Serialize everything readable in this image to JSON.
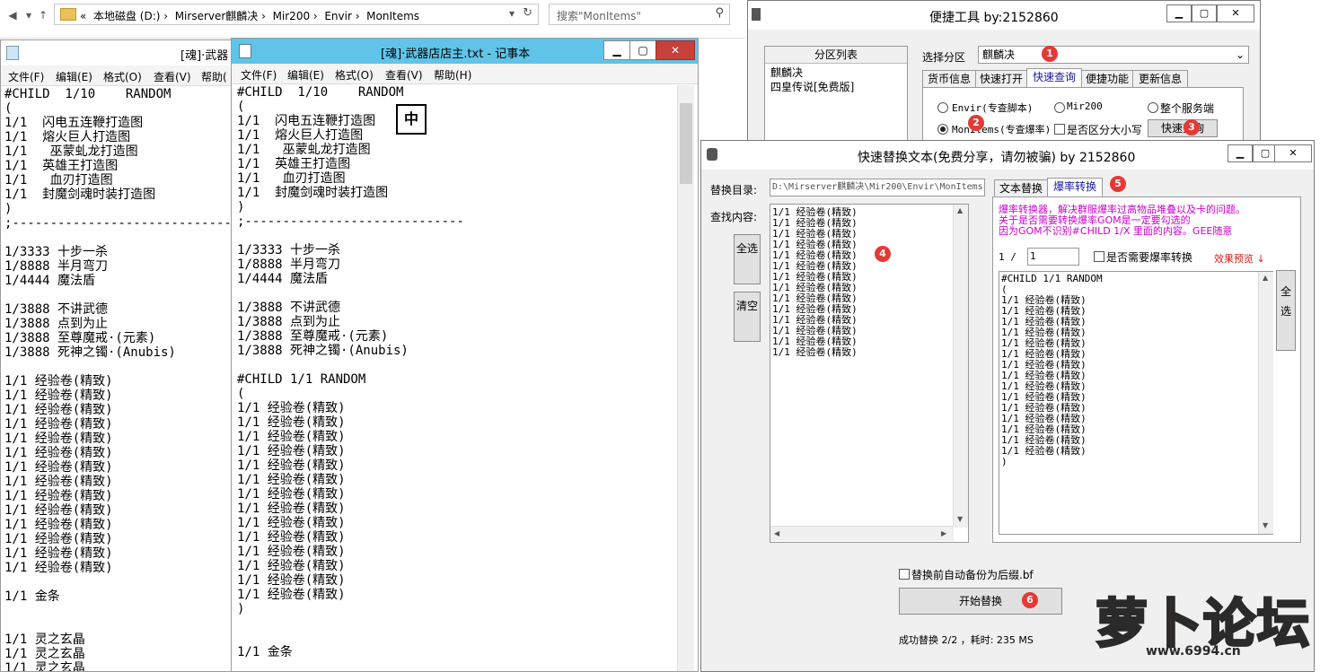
{
  "explorer": {
    "path_parts": [
      "«",
      "本地磁盘 (D:)",
      "Mirserver麒麟决",
      "Mir200",
      "Envir",
      "MonItems"
    ],
    "search_placeholder": "搜索\"MonItems\""
  },
  "notepad_left": {
    "title": "[魂]·武器",
    "menu": [
      "文件(F)",
      "编辑(E)",
      "格式(O)",
      "查看(V)",
      "帮助("
    ],
    "content": "#CHILD  1/10    RANDOM\n(\n1/1  闪电五连鞭打造图\n1/1  熔火巨人打造图\n1/1   巫蒙虬龙打造图\n1/1  英雄王打造图\n1/1   血刃打造图\n1/1  封魔剑魂时装打造图\n)\n;-----------------------------\n\n1/3333 十步一杀\n1/8888 半月弯刀\n1/4444 魔法盾\n\n1/3888 不讲武德\n1/3888 点到为止\n1/3888 至尊魔戒·(元素)\n1/3888 死神之镯·(Anubis)\n\n1/1 经验卷(精致)\n1/1 经验卷(精致)\n1/1 经验卷(精致)\n1/1 经验卷(精致)\n1/1 经验卷(精致)\n1/1 经验卷(精致)\n1/1 经验卷(精致)\n1/1 经验卷(精致)\n1/1 经验卷(精致)\n1/1 经验卷(精致)\n1/1 经验卷(精致)\n1/1 经验卷(精致)\n1/1 经验卷(精致)\n1/1 经验卷(精致)\n\n1/1 金条\n\n\n1/1 灵之玄晶\n1/1 灵之玄晶\n1/1 灵之玄晶"
  },
  "notepad_main": {
    "title": "[魂]·武器店店主.txt - 记事本",
    "menu": [
      "文件(F)",
      "编辑(E)",
      "格式(O)",
      "查看(V)",
      "帮助(H)"
    ],
    "ime": "中",
    "content": "#CHILD  1/10    RANDOM\n(\n1/1  闪电五连鞭打造图\n1/1  熔火巨人打造图\n1/1   巫蒙虬龙打造图\n1/1  英雄王打造图\n1/1   血刃打造图\n1/1  封魔剑魂时装打造图\n)\n;-----------------------------\n\n1/3333 十步一杀\n1/8888 半月弯刀\n1/4444 魔法盾\n\n1/3888 不讲武德\n1/3888 点到为止\n1/3888 至尊魔戒·(元素)\n1/3888 死神之镯·(Anubis)\n\n#CHILD 1/1 RANDOM\n(\n1/1 经验卷(精致)\n1/1 经验卷(精致)\n1/1 经验卷(精致)\n1/1 经验卷(精致)\n1/1 经验卷(精致)\n1/1 经验卷(精致)\n1/1 经验卷(精致)\n1/1 经验卷(精致)\n1/1 经验卷(精致)\n1/1 经验卷(精致)\n1/1 经验卷(精致)\n1/1 经验卷(精致)\n1/1 经验卷(精致)\n1/1 经验卷(精致)\n)\n\n\n1/1 金条"
  },
  "tool1": {
    "title": "便捷工具   by:2152860",
    "partition_list_header": "分区列表",
    "partition_items": [
      "麒麟决",
      "四皇传说[免费版]"
    ],
    "select_label": "选择分区",
    "select_value": "麒麟决",
    "tabs": [
      "货币信息",
      "快速打开",
      "快速查询",
      "便捷功能",
      "更新信息"
    ],
    "radios": [
      "Envir(专查脚本)",
      "Mir200",
      "整个服务端",
      "MonItems(专查爆率)"
    ],
    "case_check": "是否区分大小写",
    "query_button": "快速查询"
  },
  "tool2": {
    "title": "快速替换文本(免费分享，请勿被骗)   by 2152860",
    "dir_label": "替换目录:",
    "dir_value": "D:\\Mirserver麒麟决\\Mir200\\Envir\\MonItems",
    "find_label": "查找内容:",
    "select_all": "全选",
    "clear": "清空",
    "find_content": "1/1 经验卷(精致)\n1/1 经验卷(精致)\n1/1 经验卷(精致)\n1/1 经验卷(精致)\n1/1 经验卷(精致)\n1/1 经验卷(精致)\n1/1 经验卷(精致)\n1/1 经验卷(精致)\n1/1 经验卷(精致)\n1/1 经验卷(精致)\n1/1 经验卷(精致)\n1/1 经验卷(精致)\n1/1 经验卷(精致)\n1/1 经验卷(精致)",
    "tabs": [
      "文本替换",
      "爆率转换"
    ],
    "info_lines": [
      "爆率转换器，解决群服爆率过高物品堆叠以及卡的问题。",
      "关于是否需要转换爆率GOM是一定要勾选的",
      "因为GOM不识别#CHILD 1/X 里面的内容。GEE随意"
    ],
    "rate_prefix": "1 /",
    "rate_value": "1",
    "convert_check": "是否需要爆率转换",
    "preview_label": "效果预览 ↓",
    "preview_content": "#CHILD 1/1 RANDOM\n(\n1/1 经验卷(精致)\n1/1 经验卷(精致)\n1/1 经验卷(精致)\n1/1 经验卷(精致)\n1/1 经验卷(精致)\n1/1 经验卷(精致)\n1/1 经验卷(精致)\n1/1 经验卷(精致)\n1/1 经验卷(精致)\n1/1 经验卷(精致)\n1/1 经验卷(精致)\n1/1 经验卷(精致)\n1/1 经验卷(精致)\n1/1 经验卷(精致)\n1/1 经验卷(精致)\n)",
    "backup_check": "替换前自动备份为后缀.bf",
    "start_button": "开始替换",
    "status": "成功替换 2/2 ，耗时: 235 MS"
  },
  "badges": [
    "1",
    "2",
    "3",
    "4",
    "5",
    "6"
  ],
  "logo": {
    "text": "萝卜论坛",
    "url": "www.6994.cn"
  },
  "colors": {
    "accent_titlebar": "#5fc4e8",
    "info_text": "#cc00cc",
    "preview_red": "#d81b1b",
    "badge": "#e53935"
  }
}
